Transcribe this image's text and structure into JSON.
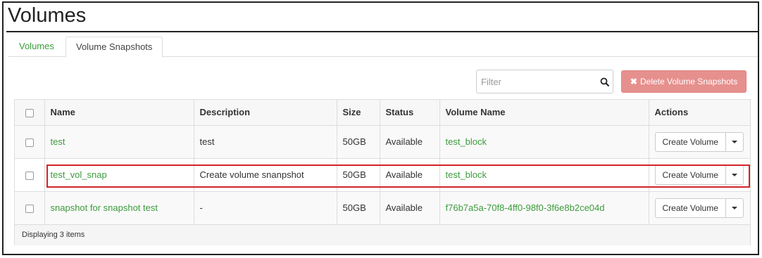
{
  "page": {
    "title": "Volumes"
  },
  "tabs": [
    {
      "label": "Volumes",
      "active": false
    },
    {
      "label": "Volume Snapshots",
      "active": true
    }
  ],
  "toolbar": {
    "filter_placeholder": "Filter",
    "delete_label": "Delete Volume Snapshots"
  },
  "table": {
    "columns": [
      "Name",
      "Description",
      "Size",
      "Status",
      "Volume Name",
      "Actions"
    ],
    "rows": [
      {
        "name": "test",
        "description": "test",
        "size": "50GB",
        "status": "Available",
        "volume_name": "test_block",
        "action": "Create Volume"
      },
      {
        "name": "test_vol_snap",
        "description": "Create volume snanpshot",
        "size": "50GB",
        "status": "Available",
        "volume_name": "test_block",
        "action": "Create Volume"
      },
      {
        "name": "snapshot for snapshot test",
        "description": "-",
        "size": "50GB",
        "status": "Available",
        "volume_name": "f76b7a5a-70f8-4ff0-98f0-3f6e8b2ce04d",
        "action": "Create Volume"
      }
    ],
    "footer": "Displaying 3 items"
  },
  "colors": {
    "link_green": "#3c9c3c",
    "delete_button": "#e6908e",
    "highlight_red": "#d2232a"
  }
}
